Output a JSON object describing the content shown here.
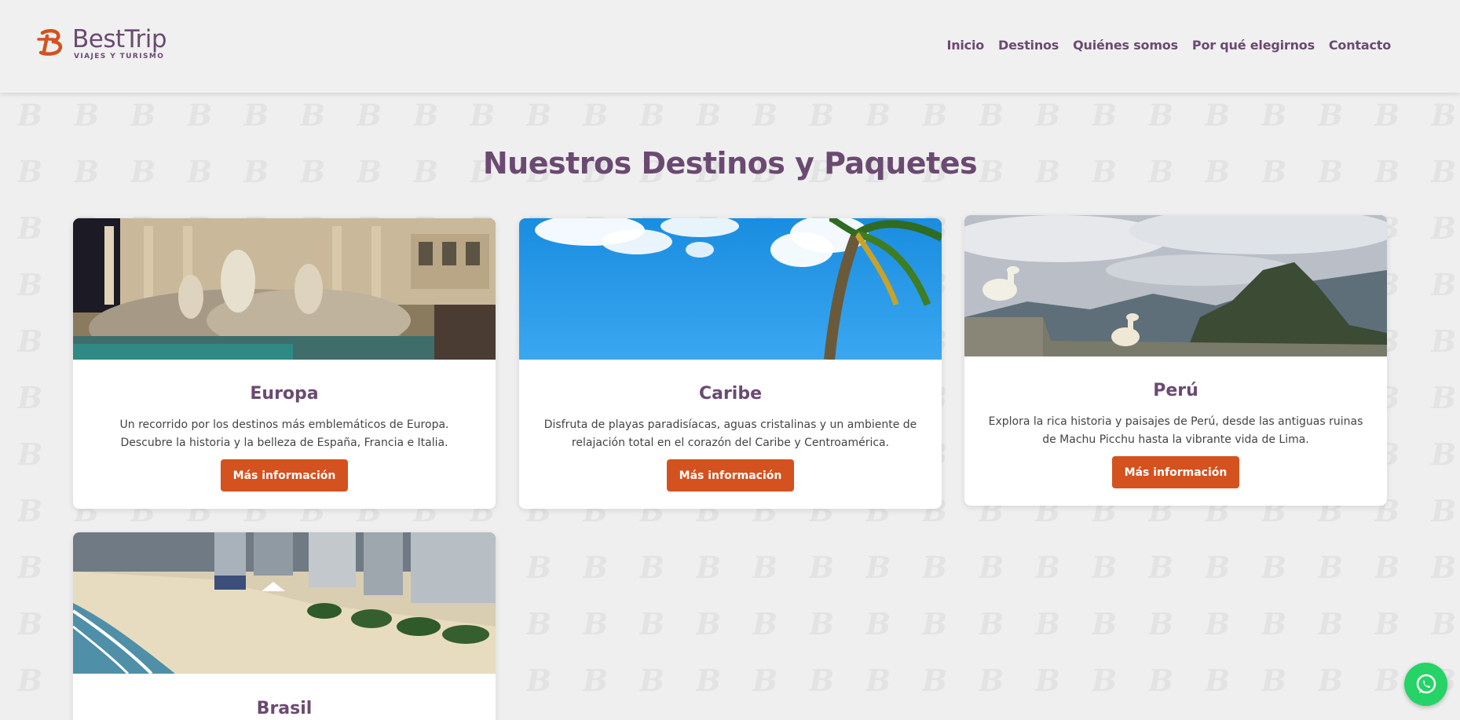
{
  "brand": {
    "name": "BestTrip",
    "tagline": "VIAJES Y TURISMO",
    "primary_color": "#6b4a72",
    "accent_color": "#d4521f",
    "logo_icon": "b-logo-icon"
  },
  "nav": {
    "items": [
      {
        "label": "Inicio"
      },
      {
        "label": "Destinos"
      },
      {
        "label": "Quiénes somos"
      },
      {
        "label": "Por qué elegirnos"
      },
      {
        "label": "Contacto"
      }
    ]
  },
  "main": {
    "title": "Nuestros Destinos y Paquetes",
    "cards": [
      {
        "title": "Europa",
        "description": "Un recorrido por los destinos más emblemáticos de Europa. Descubre la historia y la belleza de España, Francia e Italia.",
        "button": "Más información",
        "image": "trevi-fountain-photo"
      },
      {
        "title": "Caribe",
        "description": "Disfruta de playas paradisíacas, aguas cristalinas y un ambiente de relajación total en el corazón del Caribe y Centroamérica.",
        "button": "Más información",
        "image": "caribbean-sky-palm-photo"
      },
      {
        "title": "Perú",
        "description": "Explora la rica historia y paisajes de Perú, desde las antiguas ruinas de Machu Picchu hasta la vibrante vida de Lima.",
        "button": "Más información",
        "image": "machu-picchu-llamas-photo"
      },
      {
        "title": "Brasil",
        "image": "copacabana-beach-photo"
      }
    ]
  },
  "floating": {
    "whatsapp_icon": "whatsapp-icon",
    "whatsapp_color": "#25d366"
  }
}
